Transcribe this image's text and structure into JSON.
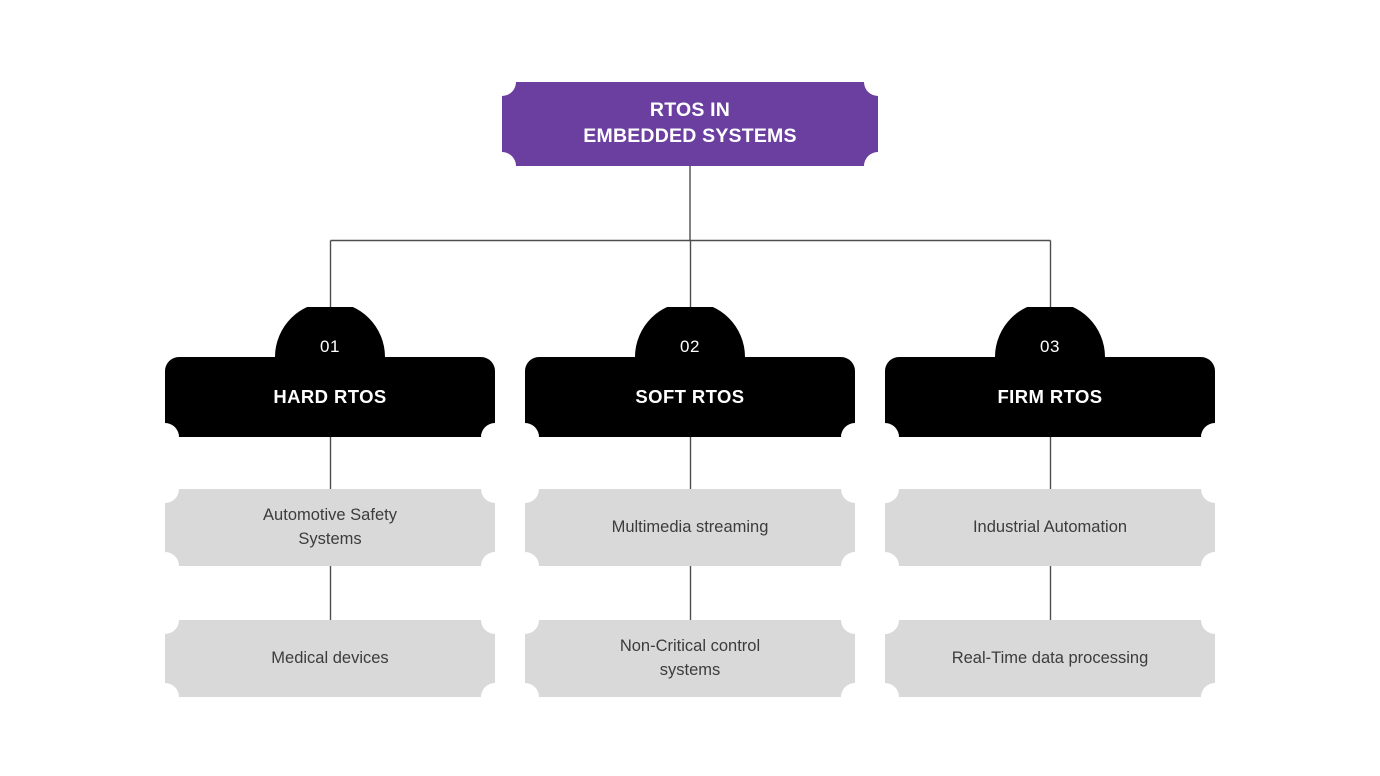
{
  "diagram": {
    "title": "RTOS IN\nEMBEDDED SYSTEMS",
    "colors": {
      "root_fill": "#6b3fa0",
      "branch_fill": "#000000",
      "leaf_fill": "#d9d9d9",
      "leaf_text": "#3c3c3c",
      "connector": "#4d4d4d",
      "background": "#ffffff",
      "on_dark_text": "#ffffff"
    },
    "branches": [
      {
        "number": "01",
        "label": "HARD RTOS",
        "leaves": [
          "Automotive Safety\nSystems",
          "Medical devices"
        ]
      },
      {
        "number": "02",
        "label": "SOFT RTOS",
        "leaves": [
          "Multimedia streaming",
          "Non-Critical control\nsystems"
        ]
      },
      {
        "number": "03",
        "label": "FIRM RTOS",
        "leaves": [
          "Industrial Automation",
          "Real-Time data processing"
        ]
      }
    ]
  }
}
